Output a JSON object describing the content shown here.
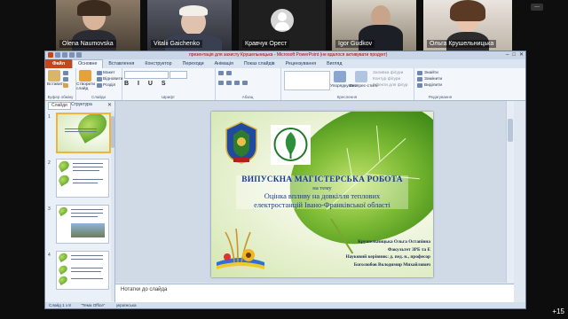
{
  "participants": [
    {
      "name": "Olena Naumovska"
    },
    {
      "name": "Vitalii Gaichenko"
    },
    {
      "name": "Кравчук Орест"
    },
    {
      "name": "Igor Gudkov"
    },
    {
      "name": "Ольга Крушельницька"
    }
  ],
  "strip_menu": "...",
  "more_participants": "+15",
  "window": {
    "title": "презентація для захисту Крушельницька - Microsoft PowerPoint (не вдалося активувати продукт)",
    "min": "–",
    "max": "□",
    "close": "✕"
  },
  "tabs": [
    "Файл",
    "Основне",
    "Вставлення",
    "Конструктор",
    "Переходи",
    "Анімація",
    "Показ слайдів",
    "Рецензування",
    "Вигляд"
  ],
  "active_tab": "Основне",
  "ribbon": {
    "paste": "Вставити",
    "cut": "Вирізати",
    "copy": "Копіювати",
    "format_painter": "Копіювати формат",
    "clipboard": "Буфер обміну",
    "new_slide": "Створити слайд",
    "layout": "Макет",
    "reset": "Відновити",
    "section": "Розділ",
    "slides": "Слайди",
    "font_group": "Шрифт",
    "para_group": "Абзац",
    "draw_group": "Креслення",
    "arrange": "Упорядкувати",
    "quick_styles": "Експрес-стилі",
    "shape_fill": "Заливка фігури",
    "shape_outline": "Контур фігури",
    "shape_effects": "Ефекти для фігур",
    "find": "Знайти",
    "replace": "Замінити",
    "select": "Виділити",
    "edit_group": "Редагування"
  },
  "side_tabs": [
    "Слайди",
    "Структура"
  ],
  "slide_numbers": [
    "1",
    "2",
    "3",
    "4"
  ],
  "slide": {
    "line1": "ВИПУСКНА МАГІСТЕРСЬКА РОБОТА",
    "line2": "на тему",
    "line3": "Оцінка впливу на довкілля теплових",
    "line4": "електростанцій Івано-Франківської області",
    "author1": "Крушельницька Ольга Остапівна",
    "author2": "Факультет ЗРБ та Е",
    "author3": "Науковий керівник: д. пед. н., професор",
    "author4": "Боголюбов Володимир Михайлович"
  },
  "notes_placeholder": "Нотатки до слайда",
  "status": {
    "slide": "Слайд 1 з 8",
    "theme": "\"Тема Office\"",
    "lang": "українська"
  }
}
